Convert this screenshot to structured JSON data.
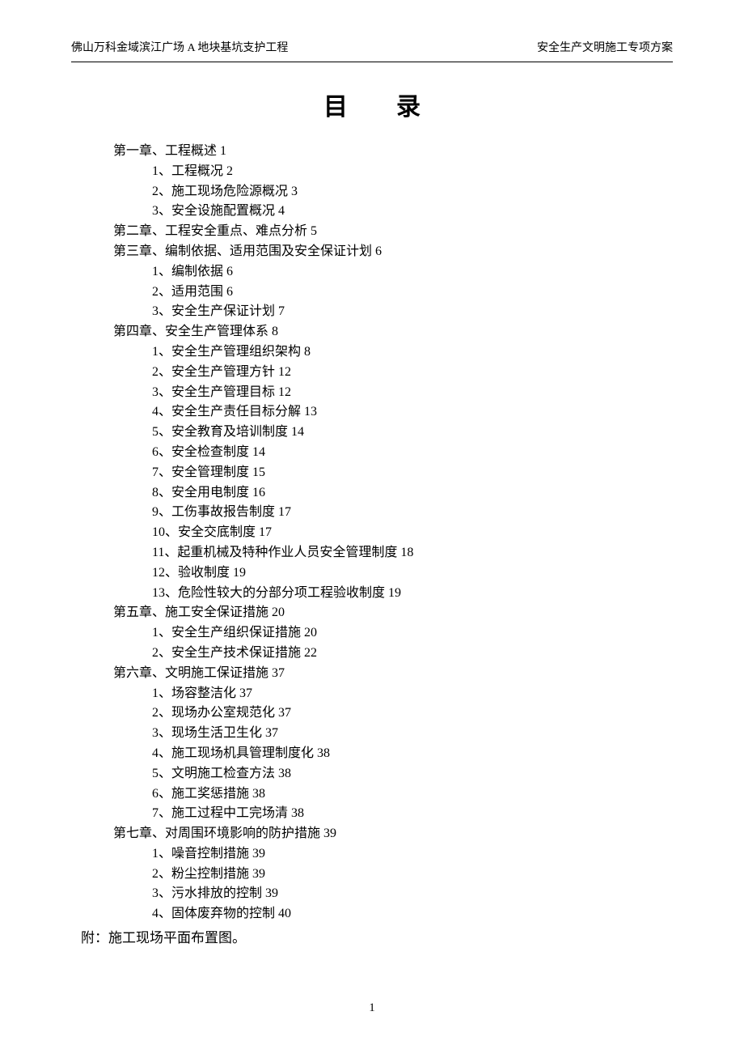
{
  "header_left": "佛山万科金域滨江广场 A 地块基坑支护工程",
  "header_right": "安全生产文明施工专项方案",
  "title": "目录",
  "toc": [
    {
      "level": 0,
      "text": "第一章、工程概述 1"
    },
    {
      "level": 1,
      "text": "1、工程概况 2"
    },
    {
      "level": 1,
      "text": "2、施工现场危险源概况 3"
    },
    {
      "level": 1,
      "text": "3、安全设施配置概况 4"
    },
    {
      "level": 0,
      "text": "第二章、工程安全重点、难点分析 5"
    },
    {
      "level": 0,
      "text": "第三章、编制依据、适用范围及安全保证计划 6"
    },
    {
      "level": 1,
      "text": "1、编制依据 6"
    },
    {
      "level": 1,
      "text": "2、适用范围 6"
    },
    {
      "level": 1,
      "text": "3、安全生产保证计划 7"
    },
    {
      "level": 0,
      "text": "第四章、安全生产管理体系 8"
    },
    {
      "level": 1,
      "text": "1、安全生产管理组织架构 8"
    },
    {
      "level": 1,
      "text": "2、安全生产管理方针 12"
    },
    {
      "level": 1,
      "text": "3、安全生产管理目标 12"
    },
    {
      "level": 1,
      "text": "4、安全生产责任目标分解 13"
    },
    {
      "level": 1,
      "text": "5、安全教育及培训制度 14"
    },
    {
      "level": 1,
      "text": "6、安全检查制度 14"
    },
    {
      "level": 1,
      "text": "7、安全管理制度 15"
    },
    {
      "level": 1,
      "text": "8、安全用电制度 16"
    },
    {
      "level": 1,
      "text": "9、工伤事故报告制度 17"
    },
    {
      "level": 1,
      "text": "10、安全交底制度 17"
    },
    {
      "level": 1,
      "text": "11、起重机械及特种作业人员安全管理制度 18"
    },
    {
      "level": 1,
      "text": "12、验收制度 19"
    },
    {
      "level": 1,
      "text": "13、危险性较大的分部分项工程验收制度 19"
    },
    {
      "level": 0,
      "text": "第五章、施工安全保证措施 20"
    },
    {
      "level": 1,
      "text": "1、安全生产组织保证措施 20"
    },
    {
      "level": 1,
      "text": "2、安全生产技术保证措施 22"
    },
    {
      "level": 0,
      "text": "第六章、文明施工保证措施 37"
    },
    {
      "level": 1,
      "text": "1、场容整洁化 37"
    },
    {
      "level": 1,
      "text": "2、现场办公室规范化 37"
    },
    {
      "level": 1,
      "text": "3、现场生活卫生化 37"
    },
    {
      "level": 1,
      "text": "4、施工现场机具管理制度化 38"
    },
    {
      "level": 1,
      "text": "5、文明施工检查方法 38"
    },
    {
      "level": 1,
      "text": "6、施工奖惩措施 38"
    },
    {
      "level": 1,
      "text": "7、施工过程中工完场清 38"
    },
    {
      "level": 0,
      "text": "第七章、对周围环境影响的防护措施 39"
    },
    {
      "level": 1,
      "text": "1、噪音控制措施 39"
    },
    {
      "level": 1,
      "text": "2、粉尘控制措施 39"
    },
    {
      "level": 1,
      "text": "3、污水排放的控制 39"
    },
    {
      "level": 1,
      "text": "4、固体废弃物的控制 40"
    }
  ],
  "appendix_label": "附：",
  "appendix_text": "施工现场平面布置图。",
  "page_number": "1"
}
